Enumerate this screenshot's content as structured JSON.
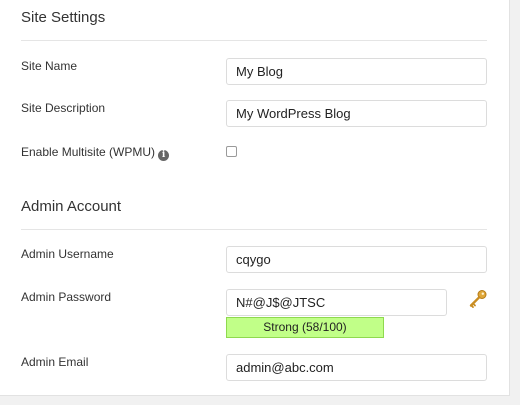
{
  "site_settings": {
    "title": "Site Settings",
    "site_name_label": "Site Name",
    "site_name_value": "My Blog",
    "site_description_label": "Site Description",
    "site_description_value": "My WordPress Blog",
    "multisite_label": "Enable Multisite (WPMU)",
    "multisite_info_icon": "info-icon",
    "multisite_checked": false
  },
  "admin_account": {
    "title": "Admin Account",
    "username_label": "Admin Username",
    "username_value": "cqygo",
    "password_label": "Admin Password",
    "password_value": "N#@J$@JTSC",
    "password_generate_icon": "key-icon",
    "strength_text": "Strong (58/100)",
    "strength_color": "#c1ff88",
    "email_label": "Admin Email",
    "email_value": "admin@abc.com"
  }
}
